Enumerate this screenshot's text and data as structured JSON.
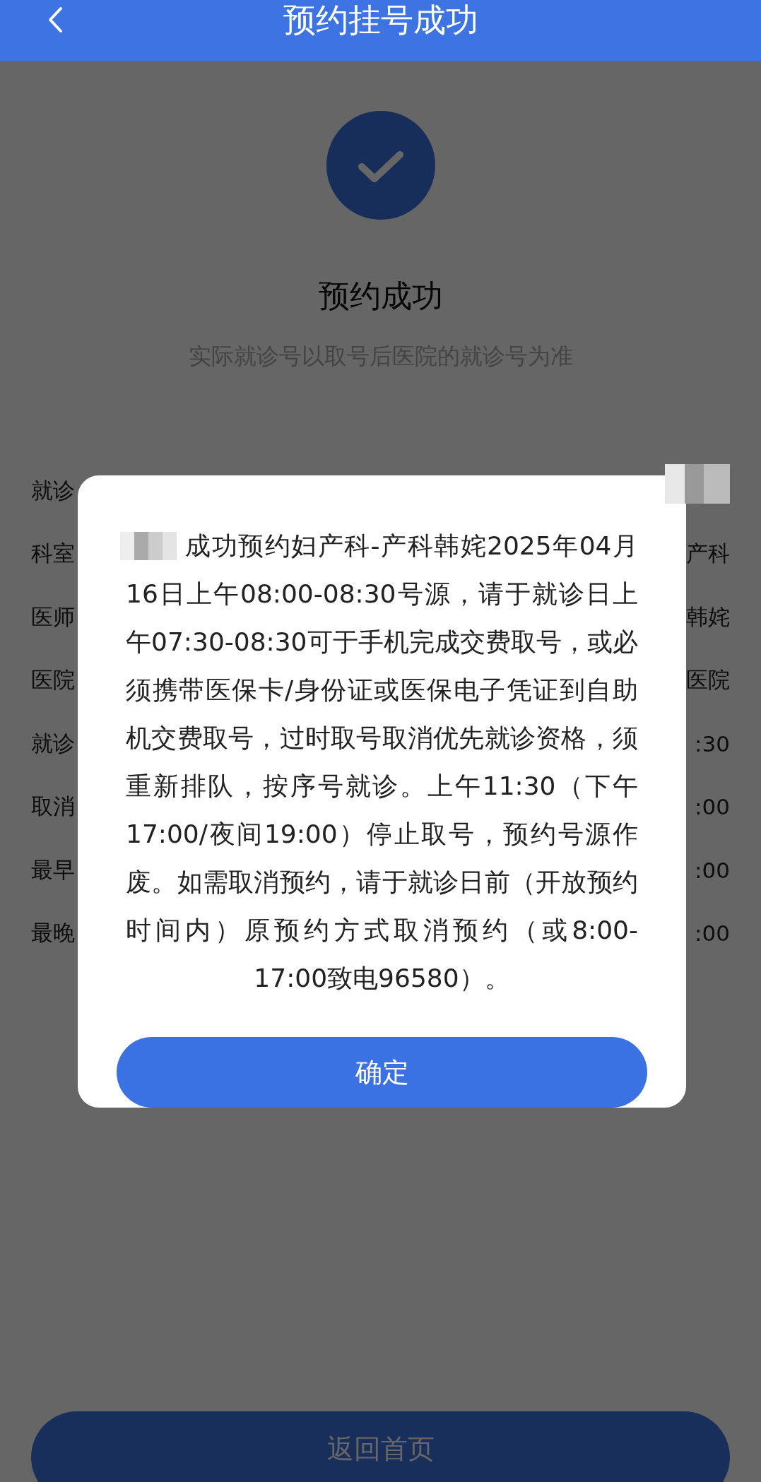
{
  "header": {
    "title": "预约挂号成功"
  },
  "result": {
    "title": "预约成功",
    "note": "实际就诊号以取号后医院的就诊号为准"
  },
  "details": [
    {
      "label": "就诊",
      "redacted": true
    },
    {
      "label": "科室",
      "value": "产科",
      "redacted": false
    },
    {
      "label": "医师",
      "value": "韩姹",
      "redacted": false
    },
    {
      "label": "医院",
      "value": "医院",
      "redacted": false
    },
    {
      "label": "就诊",
      "value": ":30",
      "redacted": false
    },
    {
      "label": "取消",
      "value": ":00",
      "redacted": false
    },
    {
      "label": "最早",
      "value": ":00",
      "redacted": false
    },
    {
      "label": "最晚",
      "value": ":00",
      "redacted": false
    }
  ],
  "dialog": {
    "redacted": true,
    "message": "成功预约妇产科-产科韩姹2025年04月16日上午08:00-08:30号源，请于就诊日上午07:30-08:30可于手机完成交费取号，或必须携带医保卡/身份证或医保电子凭证到自助机交费取号，过时取号取消优先就诊资格，须重新排队，按序号就诊。上午11:30（下午17:00/夜间19:00）停止取号，预约号源作废。如需取消预约，请于就诊日前（开放预约时间内）原预约方式取消预约（或8:00-17:00致电96580）。",
    "confirm": "确定"
  },
  "footer": {
    "button": "返回首页"
  }
}
